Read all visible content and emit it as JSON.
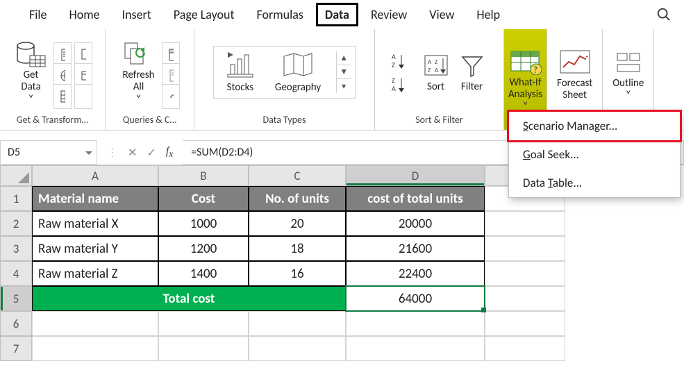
{
  "tabs": {
    "file": "File",
    "home": "Home",
    "insert": "Insert",
    "pagelayout": "Page Layout",
    "formulas": "Formulas",
    "data": "Data",
    "review": "Review",
    "view": "View",
    "help": "Help"
  },
  "ribbon": {
    "getdata": {
      "label1": "Get",
      "label2": "Data",
      "group": "Get & Transform…"
    },
    "refresh": {
      "label1": "Refresh",
      "label2": "All",
      "group": "Queries & C…"
    },
    "datatypes": {
      "stocks": "Stocks",
      "geography": "Geography",
      "group": "Data Types"
    },
    "sortfilter": {
      "sort": "Sort",
      "filter": "Filter",
      "group": "Sort & Filter"
    },
    "whatif": {
      "label1": "What-If",
      "label2": "Analysis"
    },
    "forecast": {
      "label1": "Forecast",
      "label2": "Sheet"
    },
    "outline": {
      "label": "Outline"
    }
  },
  "dropdown": {
    "scenario_pre": "S",
    "scenario_post": "cenario Manager...",
    "goal_pre": "G",
    "goal_post": "oal Seek...",
    "table_pre": "Data ",
    "table_key": "T",
    "table_post": "able..."
  },
  "namebox": "D5",
  "formula": "=SUM(D2:D4)",
  "headers": {
    "A": "A",
    "B": "B",
    "C": "C",
    "D": "D"
  },
  "rowlabels": {
    "r1": "1",
    "r2": "2",
    "r3": "3",
    "r4": "4",
    "r5": "5",
    "r6": "6",
    "r7": "7"
  },
  "table": {
    "h_material": "Material name",
    "h_cost": "Cost",
    "h_units": "No. of units",
    "h_total": "cost of total units",
    "rows": [
      {
        "name": "Raw material X",
        "cost": "1000",
        "units": "20",
        "total": "20000"
      },
      {
        "name": "Raw material Y",
        "cost": "1200",
        "units": "18",
        "total": "21600"
      },
      {
        "name": "Raw material Z",
        "cost": "1400",
        "units": "16",
        "total": "22400"
      }
    ],
    "total_label": "Total cost",
    "total_value": "64000"
  }
}
